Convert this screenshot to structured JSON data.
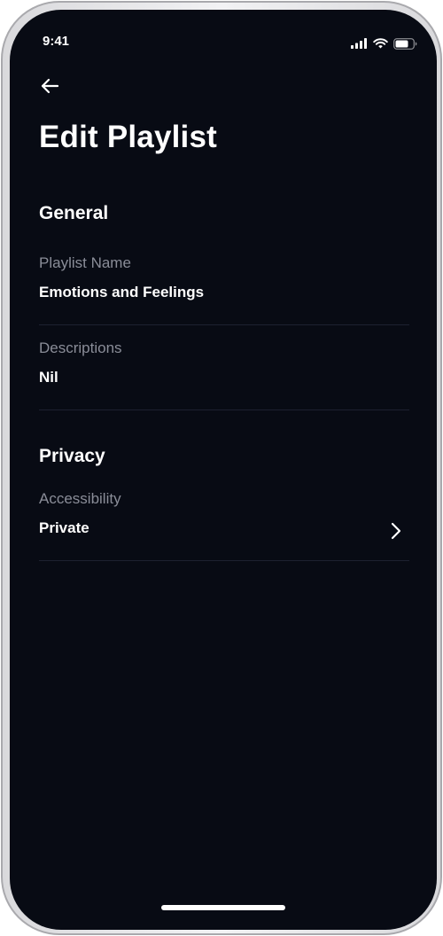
{
  "status_bar": {
    "time": "9:41",
    "icons": [
      "cellular-signal-icon",
      "wifi-icon",
      "battery-icon"
    ]
  },
  "header": {
    "back_icon": "arrow-left-icon",
    "title": "Edit Playlist"
  },
  "general": {
    "title": "General",
    "playlist_name": {
      "label": "Playlist Name",
      "value": "Emotions and Feelings"
    },
    "descriptions": {
      "label": "Descriptions",
      "value": "Nil"
    }
  },
  "privacy": {
    "title": "Privacy",
    "accessibility": {
      "label": "Accessibility",
      "value": "Private",
      "icon": "chevron-right-icon"
    }
  },
  "colors": {
    "background": "#080b14",
    "text_primary": "#ffffff",
    "text_secondary": "#8a8d98",
    "divider": "#1d2130"
  }
}
